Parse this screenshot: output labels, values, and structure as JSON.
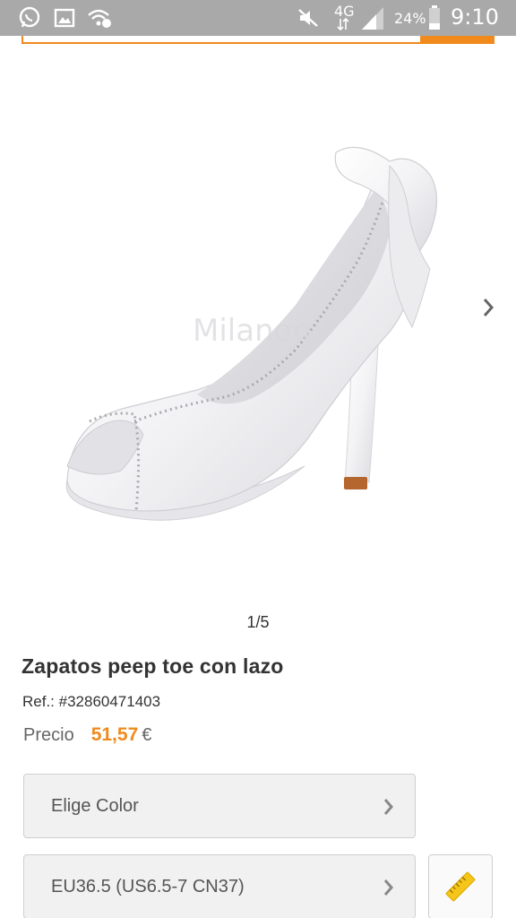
{
  "status_bar": {
    "network": "4G",
    "battery": "24%",
    "time": "9:10",
    "icons": [
      "whatsapp-icon",
      "gallery-icon",
      "wifi-call-icon",
      "mute-icon",
      "signal-icon",
      "battery-icon"
    ]
  },
  "gallery": {
    "counter": "1/5",
    "watermark": "Milanoo"
  },
  "product": {
    "title": "Zapatos peep toe con lazo",
    "ref": "Ref.: #32860471403",
    "price_label": "Precio",
    "price_value": "51,57",
    "currency": "€"
  },
  "options": {
    "color_label": "Elige Color",
    "size_label": "EU36.5 (US6.5-7 CN37)"
  },
  "colors": {
    "accent": "#f08a1c",
    "status_bar": "#a9a9a9"
  }
}
